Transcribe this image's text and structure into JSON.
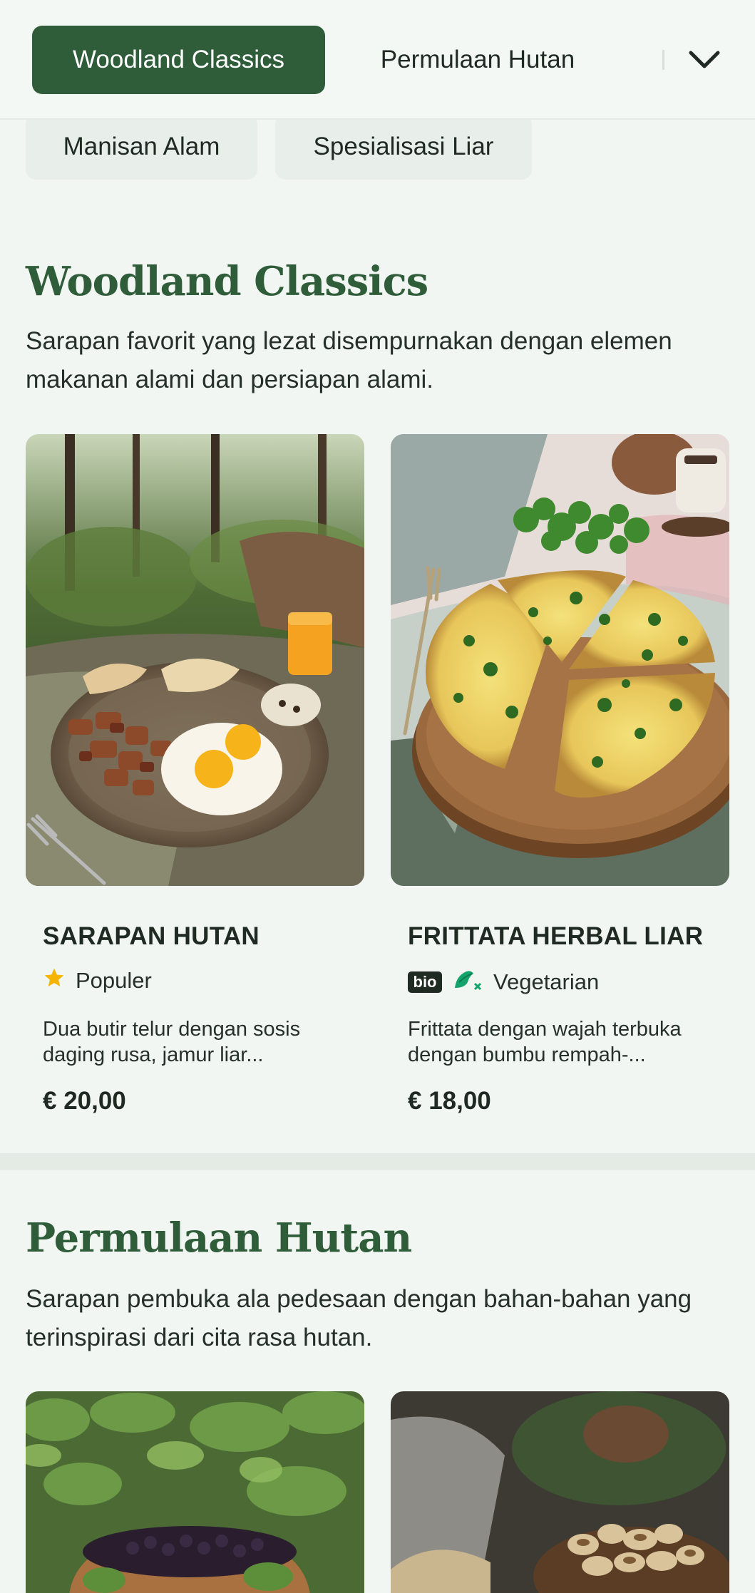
{
  "nav": {
    "tabs": [
      {
        "label": "Woodland Classics",
        "active": true
      },
      {
        "label": "Permulaan Hutan",
        "active": false
      }
    ],
    "chips": [
      {
        "label": "Manisan Alam"
      },
      {
        "label": "Spesialisasi Liar"
      }
    ],
    "expand_icon": "chevron-down-icon"
  },
  "sections": [
    {
      "title": "Woodland Classics",
      "description": "Sarapan favorit yang lezat disempurnakan dengan elemen makanan alami dan persiapan alami.",
      "items": [
        {
          "name": "SARAPAN HUTAN",
          "tag": "Populer",
          "tag_icon": "star-icon",
          "description": "Dua butir telur dengan sosis daging rusa, jamur liar...",
          "price": "€ 20,00"
        },
        {
          "name": "FRITTATA HERBAL LIAR",
          "badge": "bio",
          "tag": "Vegetarian",
          "tag_icon": "vegetarian-icon",
          "description": "Frittata dengan wajah terbuka dengan bumbu rempah-...",
          "price": "€ 18,00"
        }
      ]
    },
    {
      "title": "Permulaan Hutan",
      "description": "Sarapan pembuka ala pedesaan dengan bahan-bahan yang terinspirasi dari cita rasa hutan."
    }
  ],
  "colors": {
    "accent": "#2f5d3a",
    "background": "#f2f6f2",
    "chip": "#e8eee9",
    "star": "#f4b400",
    "veg": "#14a36b"
  }
}
